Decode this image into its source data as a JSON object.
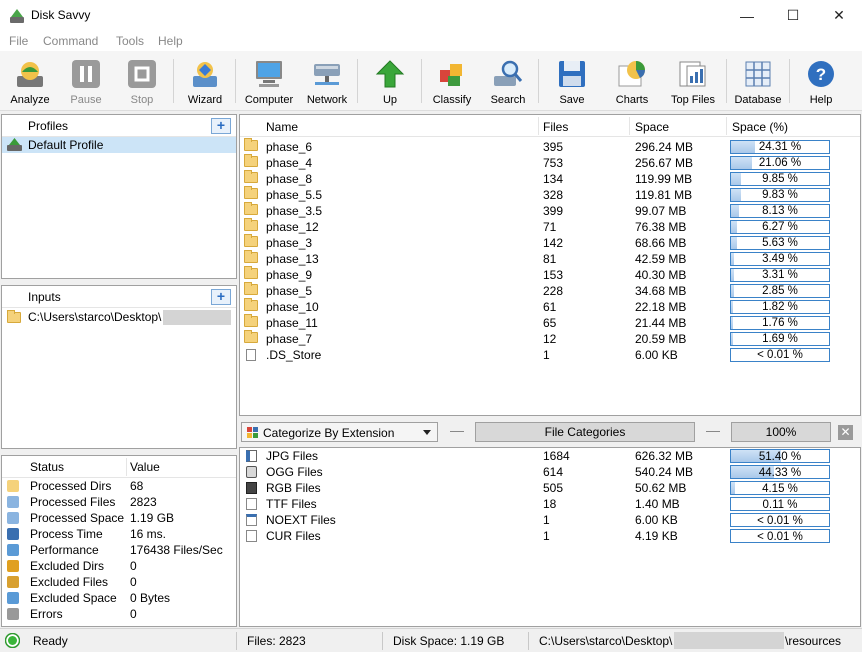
{
  "window": {
    "title": "Disk Savvy",
    "minimize": "—",
    "maximize": "☐",
    "close": "✕"
  },
  "menu": [
    "File",
    "Command",
    "Tools",
    "Help"
  ],
  "toolbar": [
    {
      "label": "Analyze",
      "icon": "analyze-icon"
    },
    {
      "label": "Pause",
      "icon": "pause-icon"
    },
    {
      "label": "Stop",
      "icon": "stop-icon"
    },
    {
      "label": "Wizard",
      "icon": "wizard-icon"
    },
    {
      "label": "Computer",
      "icon": "computer-icon"
    },
    {
      "label": "Network",
      "icon": "network-icon"
    },
    {
      "label": "Up",
      "icon": "up-arrow-icon"
    },
    {
      "label": "Classify",
      "icon": "classify-icon"
    },
    {
      "label": "Search",
      "icon": "search-icon"
    },
    {
      "label": "Save",
      "icon": "save-icon"
    },
    {
      "label": "Charts",
      "icon": "charts-icon"
    },
    {
      "label": "Top Files",
      "icon": "top-files-icon"
    },
    {
      "label": "Database",
      "icon": "database-icon"
    },
    {
      "label": "Help",
      "icon": "help-icon"
    }
  ],
  "profiles": {
    "title": "Profiles",
    "add": "+",
    "items": [
      "Default Profile"
    ]
  },
  "inputs": {
    "title": "Inputs",
    "add": "+",
    "items": [
      "C:\\Users\\starco\\Desktop\\"
    ]
  },
  "status": {
    "col_status": "Status",
    "col_value": "Value",
    "rows": [
      {
        "label": "Processed Dirs",
        "value": "68"
      },
      {
        "label": "Processed Files",
        "value": "2823"
      },
      {
        "label": "Processed Space",
        "value": "1.19 GB"
      },
      {
        "label": "Process Time",
        "value": "16 ms."
      },
      {
        "label": "Performance",
        "value": "176438 Files/Sec"
      },
      {
        "label": "Excluded Dirs",
        "value": "0"
      },
      {
        "label": "Excluded Files",
        "value": "0"
      },
      {
        "label": "Excluded Space",
        "value": "0 Bytes"
      },
      {
        "label": "Errors",
        "value": "0"
      }
    ]
  },
  "files": {
    "headers": {
      "name": "Name",
      "files": "Files",
      "space": "Space",
      "pct": "Space (%)"
    },
    "rows": [
      {
        "name": "phase_6",
        "files": "395",
        "space": "296.24 MB",
        "pct": "24.31 %",
        "frac": 0.2431,
        "type": "folder"
      },
      {
        "name": "phase_4",
        "files": "753",
        "space": "256.67 MB",
        "pct": "21.06 %",
        "frac": 0.2106,
        "type": "folder"
      },
      {
        "name": "phase_8",
        "files": "134",
        "space": "119.99 MB",
        "pct": "9.85 %",
        "frac": 0.0985,
        "type": "folder"
      },
      {
        "name": "phase_5.5",
        "files": "328",
        "space": "119.81 MB",
        "pct": "9.83 %",
        "frac": 0.0983,
        "type": "folder"
      },
      {
        "name": "phase_3.5",
        "files": "399",
        "space": "99.07 MB",
        "pct": "8.13 %",
        "frac": 0.0813,
        "type": "folder"
      },
      {
        "name": "phase_12",
        "files": "71",
        "space": "76.38 MB",
        "pct": "6.27 %",
        "frac": 0.0627,
        "type": "folder"
      },
      {
        "name": "phase_3",
        "files": "142",
        "space": "68.66 MB",
        "pct": "5.63 %",
        "frac": 0.0563,
        "type": "folder"
      },
      {
        "name": "phase_13",
        "files": "81",
        "space": "42.59 MB",
        "pct": "3.49 %",
        "frac": 0.0349,
        "type": "folder"
      },
      {
        "name": "phase_9",
        "files": "153",
        "space": "40.30 MB",
        "pct": "3.31 %",
        "frac": 0.0331,
        "type": "folder"
      },
      {
        "name": "phase_5",
        "files": "228",
        "space": "34.68 MB",
        "pct": "2.85 %",
        "frac": 0.0285,
        "type": "folder"
      },
      {
        "name": "phase_10",
        "files": "61",
        "space": "22.18 MB",
        "pct": "1.82 %",
        "frac": 0.0182,
        "type": "folder"
      },
      {
        "name": "phase_11",
        "files": "65",
        "space": "21.44 MB",
        "pct": "1.76 %",
        "frac": 0.0176,
        "type": "folder"
      },
      {
        "name": "phase_7",
        "files": "12",
        "space": "20.59 MB",
        "pct": "1.69 %",
        "frac": 0.0169,
        "type": "folder"
      },
      {
        "name": ".DS_Store",
        "files": "1",
        "space": "6.00 KB",
        "pct": "< 0.01 %",
        "frac": 0,
        "type": "file"
      }
    ]
  },
  "categorize": {
    "combo": "Categorize By Extension",
    "label": "File Categories",
    "percent": "100%",
    "close": "✕"
  },
  "categories": [
    {
      "name": "JPG Files",
      "files": "1684",
      "space": "626.32 MB",
      "pct": "51.40 %",
      "frac": 0.514,
      "icon": "jpg-icon"
    },
    {
      "name": "OGG Files",
      "files": "614",
      "space": "540.24 MB",
      "pct": "44.33 %",
      "frac": 0.4433,
      "icon": "ogg-icon"
    },
    {
      "name": "RGB Files",
      "files": "505",
      "space": "50.62 MB",
      "pct": "4.15 %",
      "frac": 0.0415,
      "icon": "rgb-icon"
    },
    {
      "name": "TTF Files",
      "files": "18",
      "space": "1.40 MB",
      "pct": "0.11 %",
      "frac": 0.0011,
      "icon": "ttf-icon"
    },
    {
      "name": "NOEXT Files",
      "files": "1",
      "space": "6.00 KB",
      "pct": "< 0.01 %",
      "frac": 0,
      "icon": "noext-icon"
    },
    {
      "name": "CUR Files",
      "files": "1",
      "space": "4.19 KB",
      "pct": "< 0.01 %",
      "frac": 0,
      "icon": "cur-icon"
    }
  ],
  "statusbar": {
    "state": "Ready",
    "files": "Files: 2823",
    "disk": "Disk Space: 1.19 GB",
    "path_prefix": "C:\\Users\\starco\\Desktop\\",
    "path_suffix": "\\resources"
  }
}
